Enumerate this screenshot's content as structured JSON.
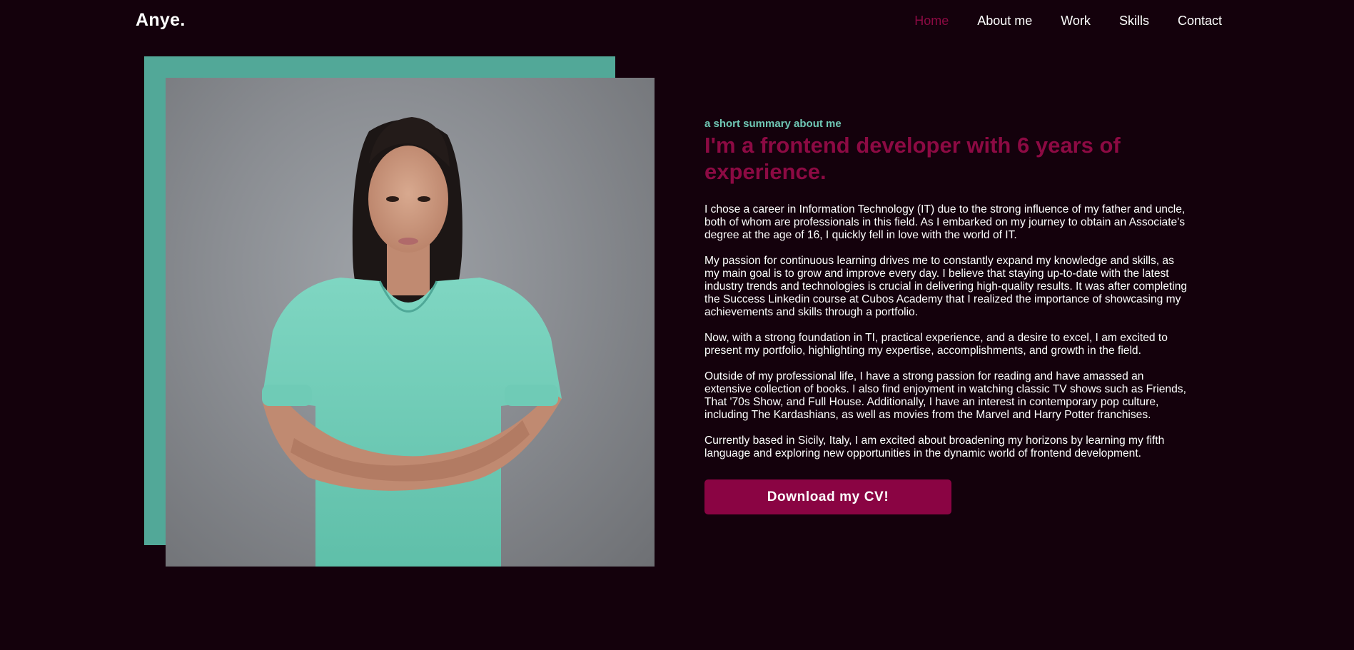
{
  "header": {
    "logo": "Anye.",
    "nav": [
      {
        "label": "Home",
        "active": true
      },
      {
        "label": "About me"
      },
      {
        "label": "Work"
      },
      {
        "label": "Skills"
      },
      {
        "label": "Contact"
      }
    ]
  },
  "about": {
    "eyebrow": "a short summary about me",
    "headline": "I'm a frontend developer with 6 years of experience.",
    "paragraphs": [
      "I chose a career in Information Technology (IT) due to the strong influence of my father and uncle, both of whom are professionals in this field. As I embarked on my journey to obtain an Associate's degree at the age of 16, I quickly fell in love with the world of IT.",
      "My passion for continuous learning drives me to constantly expand my knowledge and skills, as my main goal is to grow and improve every day. I believe that staying up-to-date with the latest industry trends and technologies is crucial in delivering high-quality results. It was after completing the Success Linkedin course at Cubos Academy that I realized the importance of showcasing my achievements and skills through a portfolio.",
      "Now, with a strong foundation in TI, practical experience, and a desire to excel, I am excited to present my portfolio, highlighting my expertise, accomplishments, and growth in the field.",
      "Outside of my professional life, I have a strong passion for reading and have amassed an extensive collection of books. I also find enjoyment in watching classic TV shows such as Friends, That '70s Show, and Full House. Additionally, I have an interest in contemporary pop culture, including The Kardashians, as well as movies from the Marvel and Harry Potter franchises.",
      "Currently based in Sicily, Italy, I am excited about broadening my horizons by learning my fifth language and exploring new opportunities in the dynamic world of frontend development."
    ],
    "cv_button": "Download my CV!"
  },
  "colors": {
    "background": "#14010c",
    "accent": "#8c0a43",
    "teal": "#52a898",
    "eyebrow": "#6fc7b4"
  }
}
